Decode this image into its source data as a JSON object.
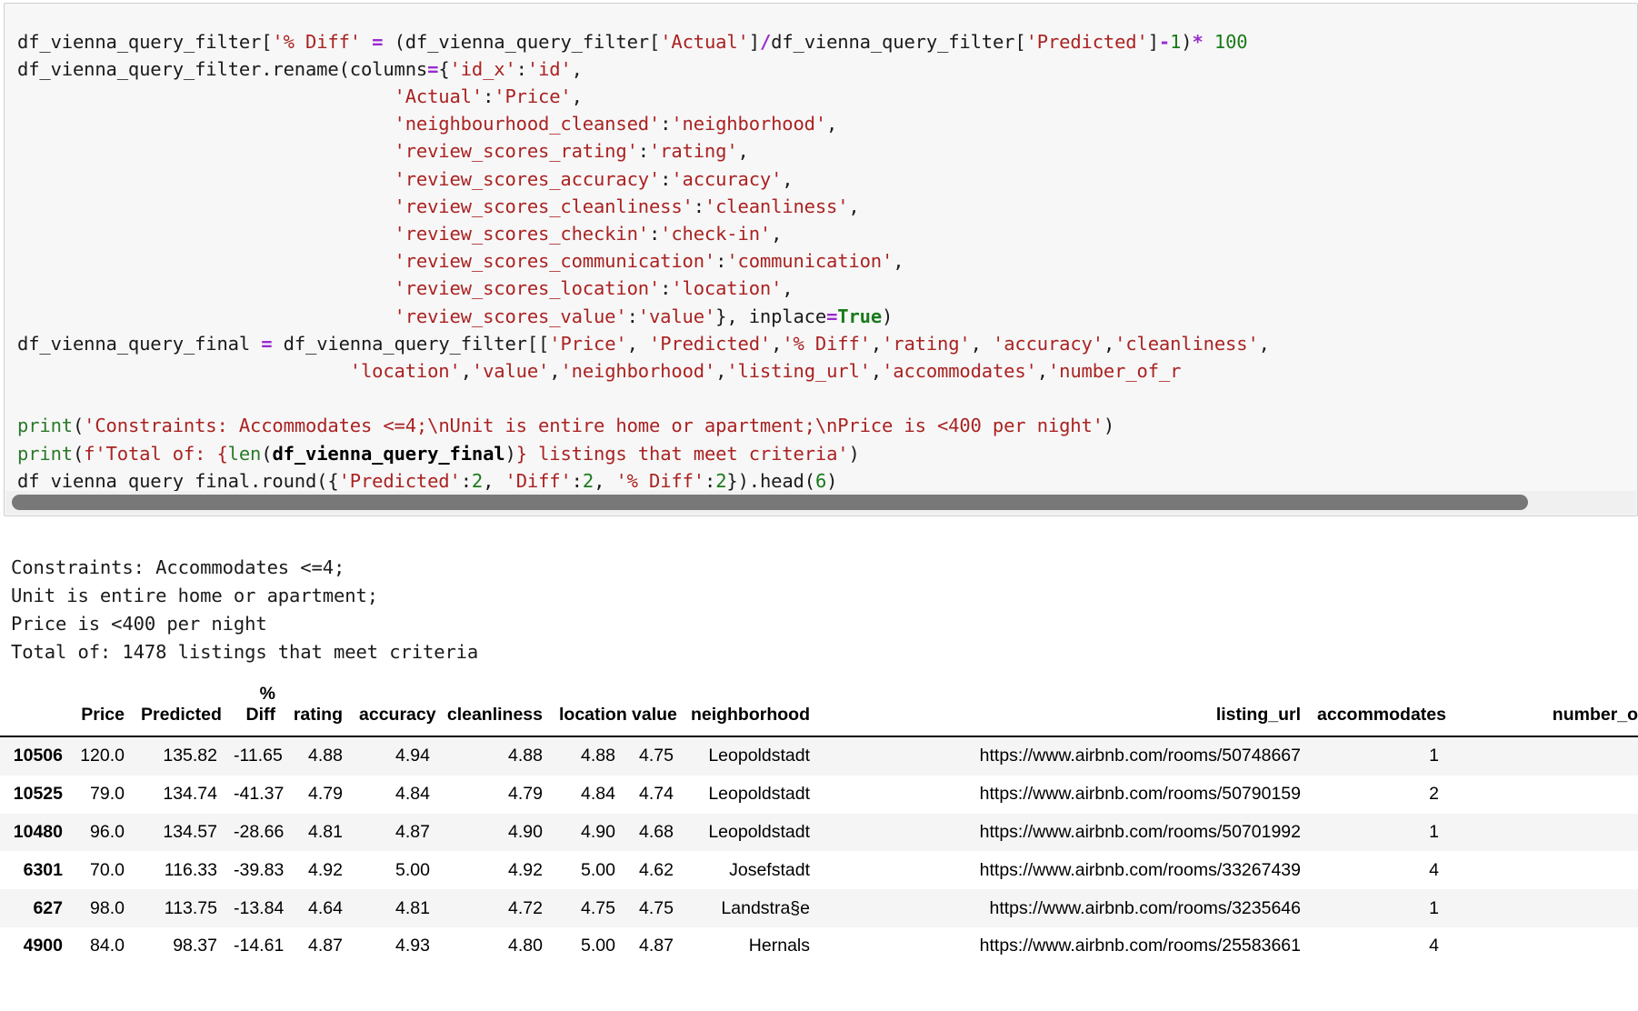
{
  "notebook": {
    "code_cell": {
      "language": "python",
      "lines": [
        [
          {
            "t": "df_vienna_query_filter[",
            "c": "plain"
          },
          {
            "t": "'% Diff'",
            "c": "str"
          },
          {
            "t": " ",
            "c": "plain"
          },
          {
            "t": "=",
            "c": "op"
          },
          {
            "t": " (df_vienna_query_filter[",
            "c": "plain"
          },
          {
            "t": "'Actual'",
            "c": "str"
          },
          {
            "t": "]",
            "c": "plain"
          },
          {
            "t": "/",
            "c": "op"
          },
          {
            "t": "df_vienna_query_filter[",
            "c": "plain"
          },
          {
            "t": "'Predicted'",
            "c": "str"
          },
          {
            "t": "]",
            "c": "plain"
          },
          {
            "t": "-",
            "c": "op"
          },
          {
            "t": "1",
            "c": "num"
          },
          {
            "t": ")",
            "c": "plain"
          },
          {
            "t": "*",
            "c": "op"
          },
          {
            "t": " ",
            "c": "plain"
          },
          {
            "t": "100",
            "c": "num"
          }
        ],
        [
          {
            "t": "df_vienna_query_filter.rename(columns",
            "c": "plain"
          },
          {
            "t": "=",
            "c": "op"
          },
          {
            "t": "{",
            "c": "plain"
          },
          {
            "t": "'id_x'",
            "c": "str"
          },
          {
            "t": ":",
            "c": "plain"
          },
          {
            "t": "'id'",
            "c": "str"
          },
          {
            "t": ",",
            "c": "plain"
          }
        ],
        [
          {
            "t": "                                  ",
            "c": "plain"
          },
          {
            "t": "'Actual'",
            "c": "str"
          },
          {
            "t": ":",
            "c": "plain"
          },
          {
            "t": "'Price'",
            "c": "str"
          },
          {
            "t": ",",
            "c": "plain"
          }
        ],
        [
          {
            "t": "                                  ",
            "c": "plain"
          },
          {
            "t": "'neighbourhood_cleansed'",
            "c": "str"
          },
          {
            "t": ":",
            "c": "plain"
          },
          {
            "t": "'neighborhood'",
            "c": "str"
          },
          {
            "t": ",",
            "c": "plain"
          }
        ],
        [
          {
            "t": "                                  ",
            "c": "plain"
          },
          {
            "t": "'review_scores_rating'",
            "c": "str"
          },
          {
            "t": ":",
            "c": "plain"
          },
          {
            "t": "'rating'",
            "c": "str"
          },
          {
            "t": ",",
            "c": "plain"
          }
        ],
        [
          {
            "t": "                                  ",
            "c": "plain"
          },
          {
            "t": "'review_scores_accuracy'",
            "c": "str"
          },
          {
            "t": ":",
            "c": "plain"
          },
          {
            "t": "'accuracy'",
            "c": "str"
          },
          {
            "t": ",",
            "c": "plain"
          }
        ],
        [
          {
            "t": "                                  ",
            "c": "plain"
          },
          {
            "t": "'review_scores_cleanliness'",
            "c": "str"
          },
          {
            "t": ":",
            "c": "plain"
          },
          {
            "t": "'cleanliness'",
            "c": "str"
          },
          {
            "t": ",",
            "c": "plain"
          }
        ],
        [
          {
            "t": "                                  ",
            "c": "plain"
          },
          {
            "t": "'review_scores_checkin'",
            "c": "str"
          },
          {
            "t": ":",
            "c": "plain"
          },
          {
            "t": "'check-in'",
            "c": "str"
          },
          {
            "t": ",",
            "c": "plain"
          }
        ],
        [
          {
            "t": "                                  ",
            "c": "plain"
          },
          {
            "t": "'review_scores_communication'",
            "c": "str"
          },
          {
            "t": ":",
            "c": "plain"
          },
          {
            "t": "'communication'",
            "c": "str"
          },
          {
            "t": ",",
            "c": "plain"
          }
        ],
        [
          {
            "t": "                                  ",
            "c": "plain"
          },
          {
            "t": "'review_scores_location'",
            "c": "str"
          },
          {
            "t": ":",
            "c": "plain"
          },
          {
            "t": "'location'",
            "c": "str"
          },
          {
            "t": ",",
            "c": "plain"
          }
        ],
        [
          {
            "t": "                                  ",
            "c": "plain"
          },
          {
            "t": "'review_scores_value'",
            "c": "str"
          },
          {
            "t": ":",
            "c": "plain"
          },
          {
            "t": "'value'",
            "c": "str"
          },
          {
            "t": "}, inplace",
            "c": "plain"
          },
          {
            "t": "=",
            "c": "op"
          },
          {
            "t": "True",
            "c": "kw"
          },
          {
            "t": ")",
            "c": "plain"
          }
        ],
        [
          {
            "t": "df_vienna_query_final ",
            "c": "plain"
          },
          {
            "t": "=",
            "c": "op"
          },
          {
            "t": " df_vienna_query_filter[[",
            "c": "plain"
          },
          {
            "t": "'Price'",
            "c": "str"
          },
          {
            "t": ", ",
            "c": "plain"
          },
          {
            "t": "'Predicted'",
            "c": "str"
          },
          {
            "t": ",",
            "c": "plain"
          },
          {
            "t": "'% Diff'",
            "c": "str"
          },
          {
            "t": ",",
            "c": "plain"
          },
          {
            "t": "'rating'",
            "c": "str"
          },
          {
            "t": ", ",
            "c": "plain"
          },
          {
            "t": "'accuracy'",
            "c": "str"
          },
          {
            "t": ",",
            "c": "plain"
          },
          {
            "t": "'cleanliness'",
            "c": "str"
          },
          {
            "t": ",",
            "c": "plain"
          }
        ],
        [
          {
            "t": "                              ",
            "c": "plain"
          },
          {
            "t": "'location'",
            "c": "str"
          },
          {
            "t": ",",
            "c": "plain"
          },
          {
            "t": "'value'",
            "c": "str"
          },
          {
            "t": ",",
            "c": "plain"
          },
          {
            "t": "'neighborhood'",
            "c": "str"
          },
          {
            "t": ",",
            "c": "plain"
          },
          {
            "t": "'listing_url'",
            "c": "str"
          },
          {
            "t": ",",
            "c": "plain"
          },
          {
            "t": "'accommodates'",
            "c": "str"
          },
          {
            "t": ",",
            "c": "plain"
          },
          {
            "t": "'number_of_r",
            "c": "str"
          }
        ],
        [],
        [
          {
            "t": "print",
            "c": "fn"
          },
          {
            "t": "(",
            "c": "plain"
          },
          {
            "t": "'Constraints: Accommodates <=4;\\nUnit is entire home or apartment;\\nPrice is <400 per night'",
            "c": "str"
          },
          {
            "t": ")",
            "c": "plain"
          }
        ],
        [
          {
            "t": "print",
            "c": "fn"
          },
          {
            "t": "(",
            "c": "plain"
          },
          {
            "t": "f'Total of: {",
            "c": "str"
          },
          {
            "t": "len",
            "c": "fn"
          },
          {
            "t": "(",
            "c": "plain"
          },
          {
            "t": "df_vienna_query_final",
            "c": "bold"
          },
          {
            "t": ")",
            "c": "plain"
          },
          {
            "t": "} listings that meet criteria'",
            "c": "str"
          },
          {
            "t": ")",
            "c": "plain"
          }
        ],
        [
          {
            "t": "df_vienna_query_final.round({",
            "c": "plain"
          },
          {
            "t": "'Predicted'",
            "c": "str"
          },
          {
            "t": ":",
            "c": "plain"
          },
          {
            "t": "2",
            "c": "num"
          },
          {
            "t": ", ",
            "c": "plain"
          },
          {
            "t": "'Diff'",
            "c": "str"
          },
          {
            "t": ":",
            "c": "plain"
          },
          {
            "t": "2",
            "c": "num"
          },
          {
            "t": ", ",
            "c": "plain"
          },
          {
            "t": "'% Diff'",
            "c": "str"
          },
          {
            "t": ":",
            "c": "plain"
          },
          {
            "t": "2",
            "c": "num"
          },
          {
            "t": "}).head(",
            "c": "plain"
          },
          {
            "t": "6",
            "c": "num"
          },
          {
            "t": ")",
            "c": "plain"
          }
        ]
      ],
      "scrollbar": {
        "orientation": "horizontal",
        "thumb_position": "left"
      }
    },
    "stdout": [
      "Constraints: Accommodates <=4;",
      "Unit is entire home or apartment;",
      "Price is <400 per night",
      "Total of: 1478 listings that meet criteria"
    ],
    "dataframe": {
      "columns": [
        "",
        "Price",
        "Predicted",
        "% Diff",
        "rating",
        "accuracy",
        "cleanliness",
        "location",
        "value",
        "neighborhood",
        "listing_url",
        "accommodates",
        "number_of_r"
      ],
      "rows": [
        {
          "index": "10506",
          "price": "120.0",
          "predicted": "135.82",
          "pct_diff": "-11.65",
          "rating": "4.88",
          "accuracy": "4.94",
          "cleanliness": "4.88",
          "location": "4.88",
          "value": "4.75",
          "neighborhood": "Leopoldstadt",
          "listing_url": "https://www.airbnb.com/rooms/50748667",
          "accommodates": "1",
          "number_of_r": ""
        },
        {
          "index": "10525",
          "price": "79.0",
          "predicted": "134.74",
          "pct_diff": "-41.37",
          "rating": "4.79",
          "accuracy": "4.84",
          "cleanliness": "4.79",
          "location": "4.84",
          "value": "4.74",
          "neighborhood": "Leopoldstadt",
          "listing_url": "https://www.airbnb.com/rooms/50790159",
          "accommodates": "2",
          "number_of_r": ""
        },
        {
          "index": "10480",
          "price": "96.0",
          "predicted": "134.57",
          "pct_diff": "-28.66",
          "rating": "4.81",
          "accuracy": "4.87",
          "cleanliness": "4.90",
          "location": "4.90",
          "value": "4.68",
          "neighborhood": "Leopoldstadt",
          "listing_url": "https://www.airbnb.com/rooms/50701992",
          "accommodates": "1",
          "number_of_r": ""
        },
        {
          "index": "6301",
          "price": "70.0",
          "predicted": "116.33",
          "pct_diff": "-39.83",
          "rating": "4.92",
          "accuracy": "5.00",
          "cleanliness": "4.92",
          "location": "5.00",
          "value": "4.62",
          "neighborhood": "Josefstadt",
          "listing_url": "https://www.airbnb.com/rooms/33267439",
          "accommodates": "4",
          "number_of_r": ""
        },
        {
          "index": "627",
          "price": "98.0",
          "predicted": "113.75",
          "pct_diff": "-13.84",
          "rating": "4.64",
          "accuracy": "4.81",
          "cleanliness": "4.72",
          "location": "4.75",
          "value": "4.75",
          "neighborhood": "Landstra§e",
          "listing_url": "https://www.airbnb.com/rooms/3235646",
          "accommodates": "1",
          "number_of_r": ""
        },
        {
          "index": "4900",
          "price": "84.0",
          "predicted": "98.37",
          "pct_diff": "-14.61",
          "rating": "4.87",
          "accuracy": "4.93",
          "cleanliness": "4.80",
          "location": "5.00",
          "value": "4.87",
          "neighborhood": "Hernals",
          "listing_url": "https://www.airbnb.com/rooms/25583661",
          "accommodates": "4",
          "number_of_r": ""
        }
      ]
    },
    "colors": {
      "cell_background": "#f7f7f7",
      "string_token": "#aa2222",
      "number_token": "#1a7a1a",
      "operator_token": "#9a2ad0",
      "function_token": "#2a7a2a",
      "row_stripe": "#f5f5f5",
      "scrollbar_thumb": "#787878"
    }
  }
}
